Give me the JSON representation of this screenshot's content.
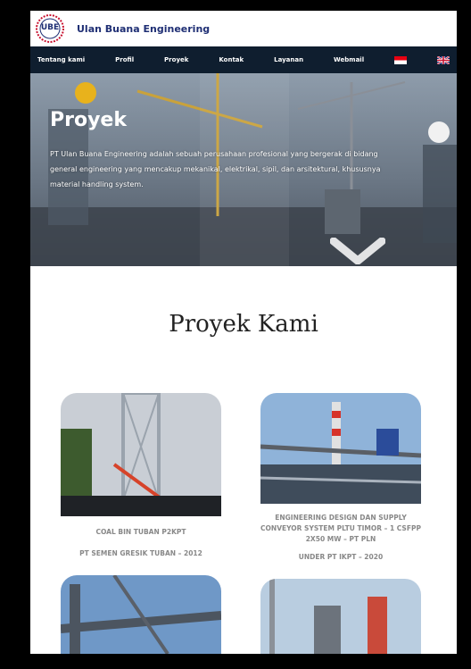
{
  "header": {
    "brand": "Ulan Buana Engineering",
    "logo_text": "UBE"
  },
  "nav": {
    "items": [
      "Tentang kami",
      "Profil",
      "Proyek",
      "Kontak",
      "Layanan",
      "Webmail"
    ]
  },
  "hero": {
    "title": "Proyek",
    "description": "PT Ulan Buana Engineering adalah sebuah perusahaan profesional yang bergerak di bidang general engineering yang mencakup mekanikal, elektrikal, sipil, dan arsitektural, khususnya material handling system."
  },
  "section": {
    "title": "Proyek Kami"
  },
  "projects": [
    {
      "title": "COAL BIN TUBAN P2KPT",
      "subtitle": "PT SEMEN GRESIK TUBAN – 2012"
    },
    {
      "title": "ENGINEERING DESIGN DAN SUPPLY CONVEYOR SYSTEM PLTU TIMOR – 1 CSFPP 2X50 MW – PT PLN",
      "subtitle": "UNDER PT IKPT – 2020"
    }
  ],
  "colors": {
    "nav_bg": "#0f1e2f",
    "brand": "#1f2f74"
  }
}
